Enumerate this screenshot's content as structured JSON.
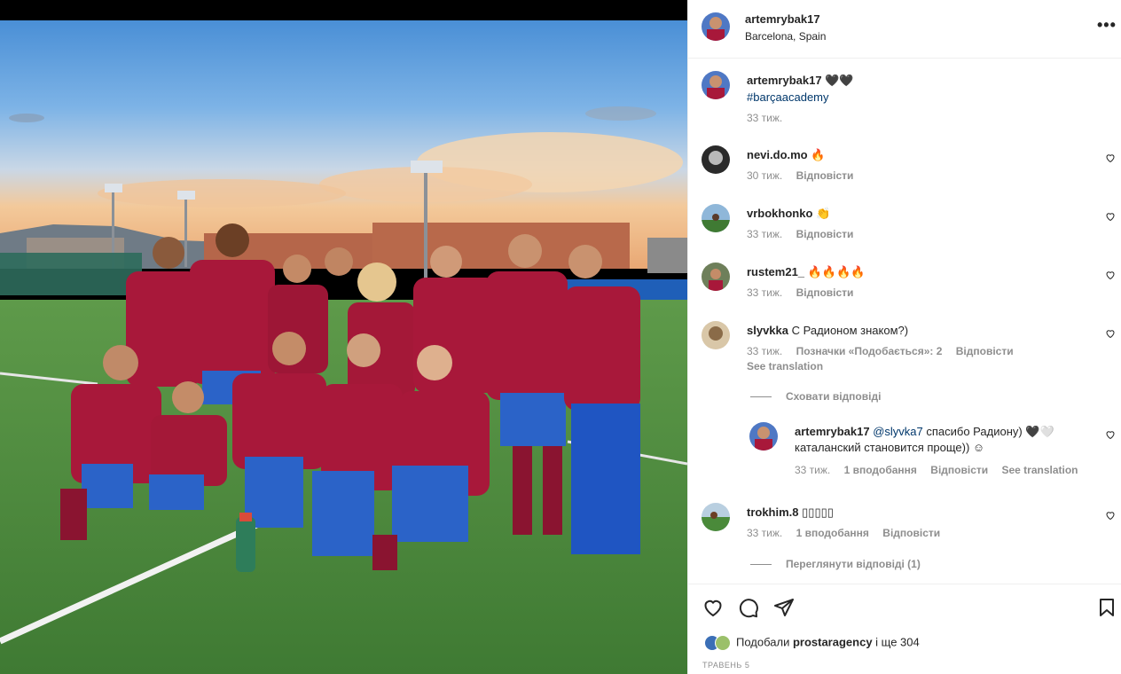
{
  "post": {
    "username": "artemrybak17",
    "location": "Barcelona, Spain",
    "more_label": "•••"
  },
  "caption": {
    "username": "artemrybak17",
    "emoji": "🖤🖤",
    "hashtag": "#barçaacademy",
    "time": "33 тиж."
  },
  "comments": [
    {
      "username": "nevi.do.mo",
      "text": "🔥",
      "time": "30 тиж.",
      "reply": "Відповісти"
    },
    {
      "username": "vrbokhonko",
      "text": "👏",
      "time": "33 тиж.",
      "reply": "Відповісти"
    },
    {
      "username": "rustem21_",
      "text": "🔥🔥🔥🔥",
      "time": "33 тиж.",
      "reply": "Відповісти"
    },
    {
      "username": "slyvkka",
      "text": "С Радионом знаком?)",
      "time": "33 тиж.",
      "likes": "Позначки «Подобається»: 2",
      "reply": "Відповісти",
      "translate": "See translation"
    }
  ],
  "hide_replies": "Сховати відповіді",
  "reply": {
    "username": "artemrybak17",
    "mention": "@slyvka7",
    "text_line1": " спасибо Радиону) 🖤🤍",
    "text_line2": "каталанский становится проще)) ☺",
    "time": "33 тиж.",
    "likes": "1 вподобання",
    "reply": "Відповісти",
    "translate": "See translation"
  },
  "comment_last": {
    "username": "trokhim.8",
    "text": "▯▯▯▯▯",
    "time": "33 тиж.",
    "likes": "1 вподобання",
    "reply": "Відповісти"
  },
  "view_replies": "Переглянути відповіді (1)",
  "likes_bar": {
    "prefix": "Подобали ",
    "user": "prostaragency",
    "suffix": " і ще 304"
  },
  "date": "ТРАВЕНЬ 5",
  "icons": {
    "more": "more-icon",
    "heart": "heart-icon",
    "comment": "comment-icon",
    "share": "share-icon",
    "save": "bookmark-icon"
  },
  "colors": {
    "link": "#00376b",
    "muted": "#8e8e8e",
    "text": "#262626"
  }
}
